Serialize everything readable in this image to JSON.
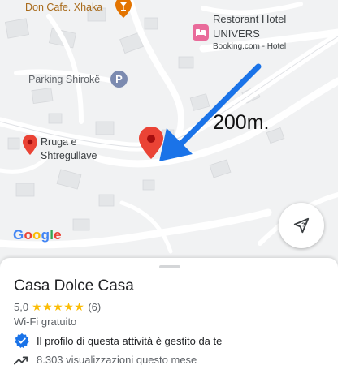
{
  "map": {
    "pois": {
      "cafe": "Don Cafe. Xhaka",
      "hotel_name_line1": "Restorant Hotel",
      "hotel_name_line2": "UNIVERS",
      "hotel_sub": "Booking.com - Hotel",
      "parking": "Parking Shirokë",
      "parking_glyph": "P",
      "rruga_line1": "Rruga e",
      "rruga_line2": "Shtregullave"
    },
    "annotation": "200m.",
    "attribution": [
      "G",
      "o",
      "o",
      "g",
      "l",
      "e"
    ],
    "colors": {
      "red_pin": "#ea4335",
      "arrow": "#1a73e8",
      "parking_badge": "#7c8bb0",
      "hotel_badge": "#e96b9a"
    },
    "location_button_icon": "location-arrow-icon"
  },
  "place": {
    "name": "Casa Dolce Casa",
    "rating": "5,0",
    "stars": "★★★★★",
    "review_count": "(6)",
    "amenity": "Wi-Fi gratuito",
    "managed_text": "Il profilo di questa attività è gestito da te",
    "views_text": "8.303 visualizzazioni questo mese"
  }
}
